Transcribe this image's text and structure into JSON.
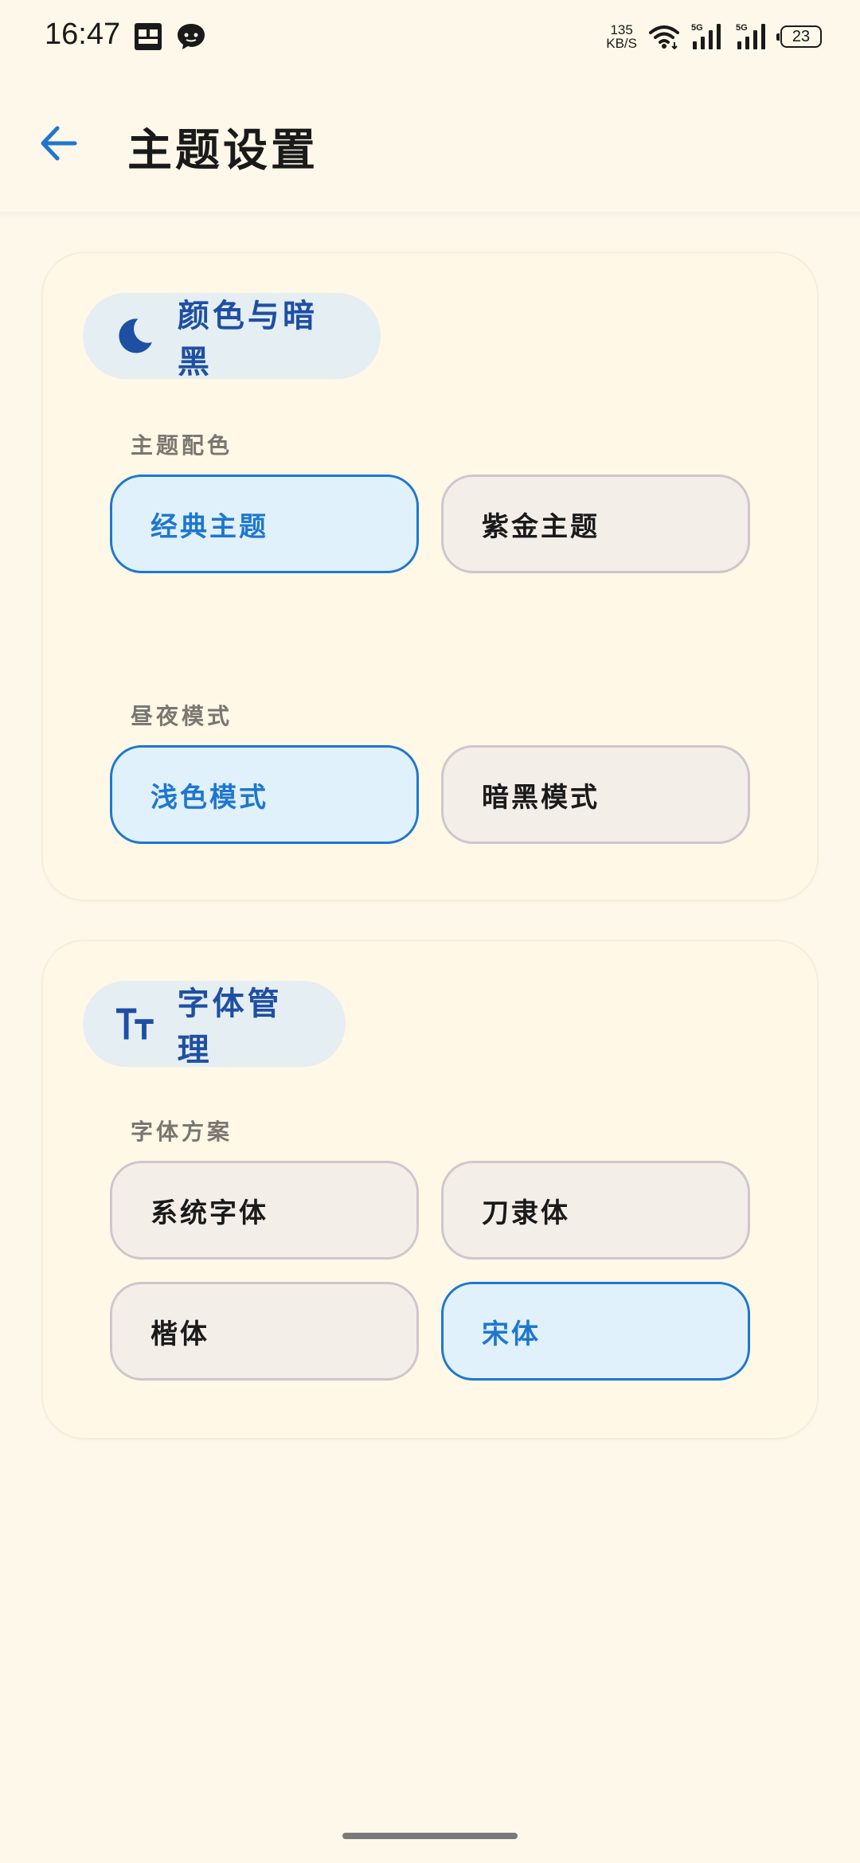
{
  "status_bar": {
    "time": "16:47",
    "net_speed_value": "135",
    "net_speed_unit": "KB/S",
    "battery": "23",
    "icons": [
      "gallery-app-icon",
      "chat-app-icon",
      "wifi-icon",
      "signal-5g-icon",
      "signal-5g-icon",
      "battery-icon"
    ]
  },
  "header": {
    "title": "主题设置",
    "back_icon": "arrow-left-icon"
  },
  "colors": {
    "background": "#fdf8e9",
    "card": "#fff8e6",
    "pill": "#e5eef3",
    "accent": "#1e77cf",
    "accent_dark": "#1e4fa3",
    "unselected_bg": "#f4eee9",
    "unselected_border": "#cfc6cc"
  },
  "sections": {
    "appearance": {
      "icon": "moon-icon",
      "title": "颜色与暗黑",
      "theme_color": {
        "label": "主题配色",
        "options": [
          {
            "label": "经典主题",
            "selected": true
          },
          {
            "label": "紫金主题",
            "selected": false
          }
        ]
      },
      "day_night": {
        "label": "昼夜模式",
        "options": [
          {
            "label": "浅色模式",
            "selected": true
          },
          {
            "label": "暗黑模式",
            "selected": false
          }
        ]
      }
    },
    "font": {
      "icon": "text-size-icon",
      "title": "字体管理",
      "scheme": {
        "label": "字体方案",
        "options": [
          {
            "label": "系统字体",
            "selected": false
          },
          {
            "label": "刀隶体",
            "selected": false
          },
          {
            "label": "楷体",
            "selected": false
          },
          {
            "label": "宋体",
            "selected": true
          }
        ]
      }
    }
  }
}
